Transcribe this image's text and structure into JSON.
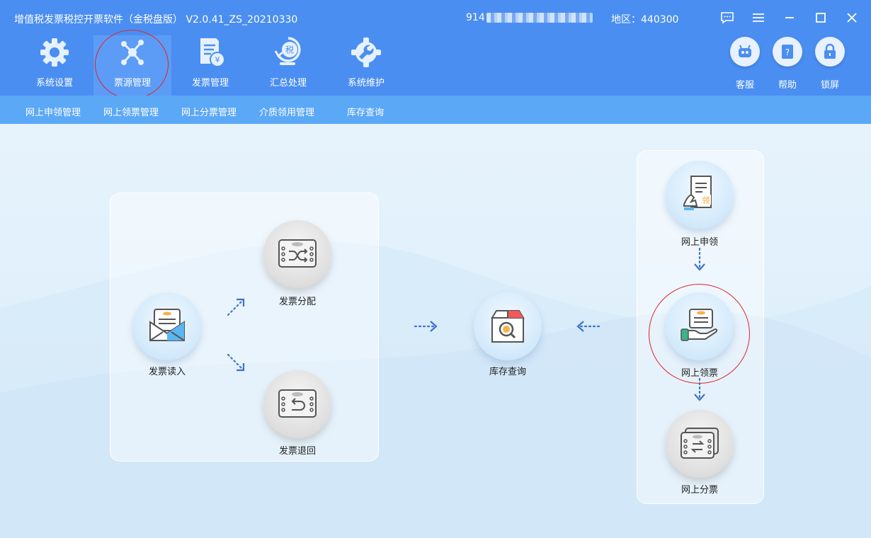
{
  "titlebar": {
    "title": "增值税发票税控开票软件（金税盘版） V2.0.41_ZS_20210330",
    "taxid_prefix": "914",
    "region": "地区：440300"
  },
  "window_controls": [
    "message-icon",
    "menu-icon",
    "minimize-icon",
    "maximize-icon",
    "close-icon"
  ],
  "tabs": [
    {
      "label": "系统设置",
      "icon": "gear-icon"
    },
    {
      "label": "票源管理",
      "icon": "network-icon",
      "active": true
    },
    {
      "label": "发票管理",
      "icon": "invoice-icon"
    },
    {
      "label": "汇总处理",
      "icon": "tax-summary-icon"
    },
    {
      "label": "系统维护",
      "icon": "wrench-icon"
    }
  ],
  "right_buttons": [
    {
      "label": "客服",
      "icon": "robot-icon"
    },
    {
      "label": "帮助",
      "icon": "help-book-icon"
    },
    {
      "label": "锁屏",
      "icon": "lock-icon"
    }
  ],
  "subnav": [
    "网上申领管理",
    "网上领票管理",
    "网上分票管理",
    "介质领用管理",
    "库存查询"
  ],
  "flow": {
    "read": "发票读入",
    "allocate": "发票分配",
    "return": "发票退回",
    "inventory": "库存查询",
    "apply": "网上申领",
    "receive": "网上领票",
    "split": "网上分票"
  },
  "colors": {
    "header": "#4a8ef2",
    "subnav": "#5ba8f6",
    "highlight": "#e0242a"
  }
}
